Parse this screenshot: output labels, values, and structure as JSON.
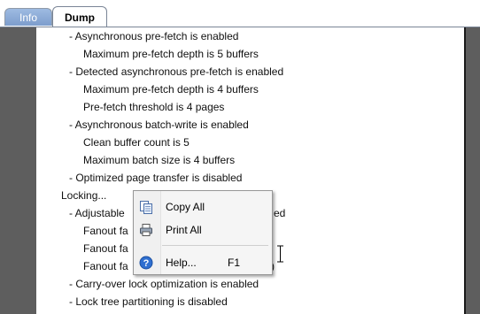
{
  "tabs": [
    {
      "label": "Info"
    },
    {
      "label": "Dump"
    }
  ],
  "dump_lines": [
    "- Asynchronous pre-fetch is enabled",
    "Maximum pre-fetch depth is 5 buffers",
    "- Detected asynchronous pre-fetch is enabled",
    "Maximum pre-fetch depth is 4 buffers",
    "Pre-fetch threshold is 4 pages",
    "- Asynchronous batch-write is enabled",
    "Clean buffer count is 5",
    "Maximum batch size is 4 buffers",
    "- Optimized page transfer is disabled",
    "Locking...",
    "- Adjustable",
    "ed",
    "Fanout fa",
    "Fanout fa",
    ")",
    "Fanout fa",
    "s)",
    "- Carry-over lock optimization is enabled",
    "- Lock tree partitioning is disabled"
  ],
  "context_menu": {
    "items": [
      {
        "label": "Copy All",
        "icon": "copy-icon"
      },
      {
        "label": "Print All",
        "icon": "printer-icon"
      },
      {
        "label": "Help...",
        "shortcut": "F1",
        "icon": "help-icon"
      }
    ]
  },
  "colors": {
    "active_tab": "#ffffff",
    "inactive_tab": "#7d9dcc",
    "gutter": "#5e5e5e"
  }
}
